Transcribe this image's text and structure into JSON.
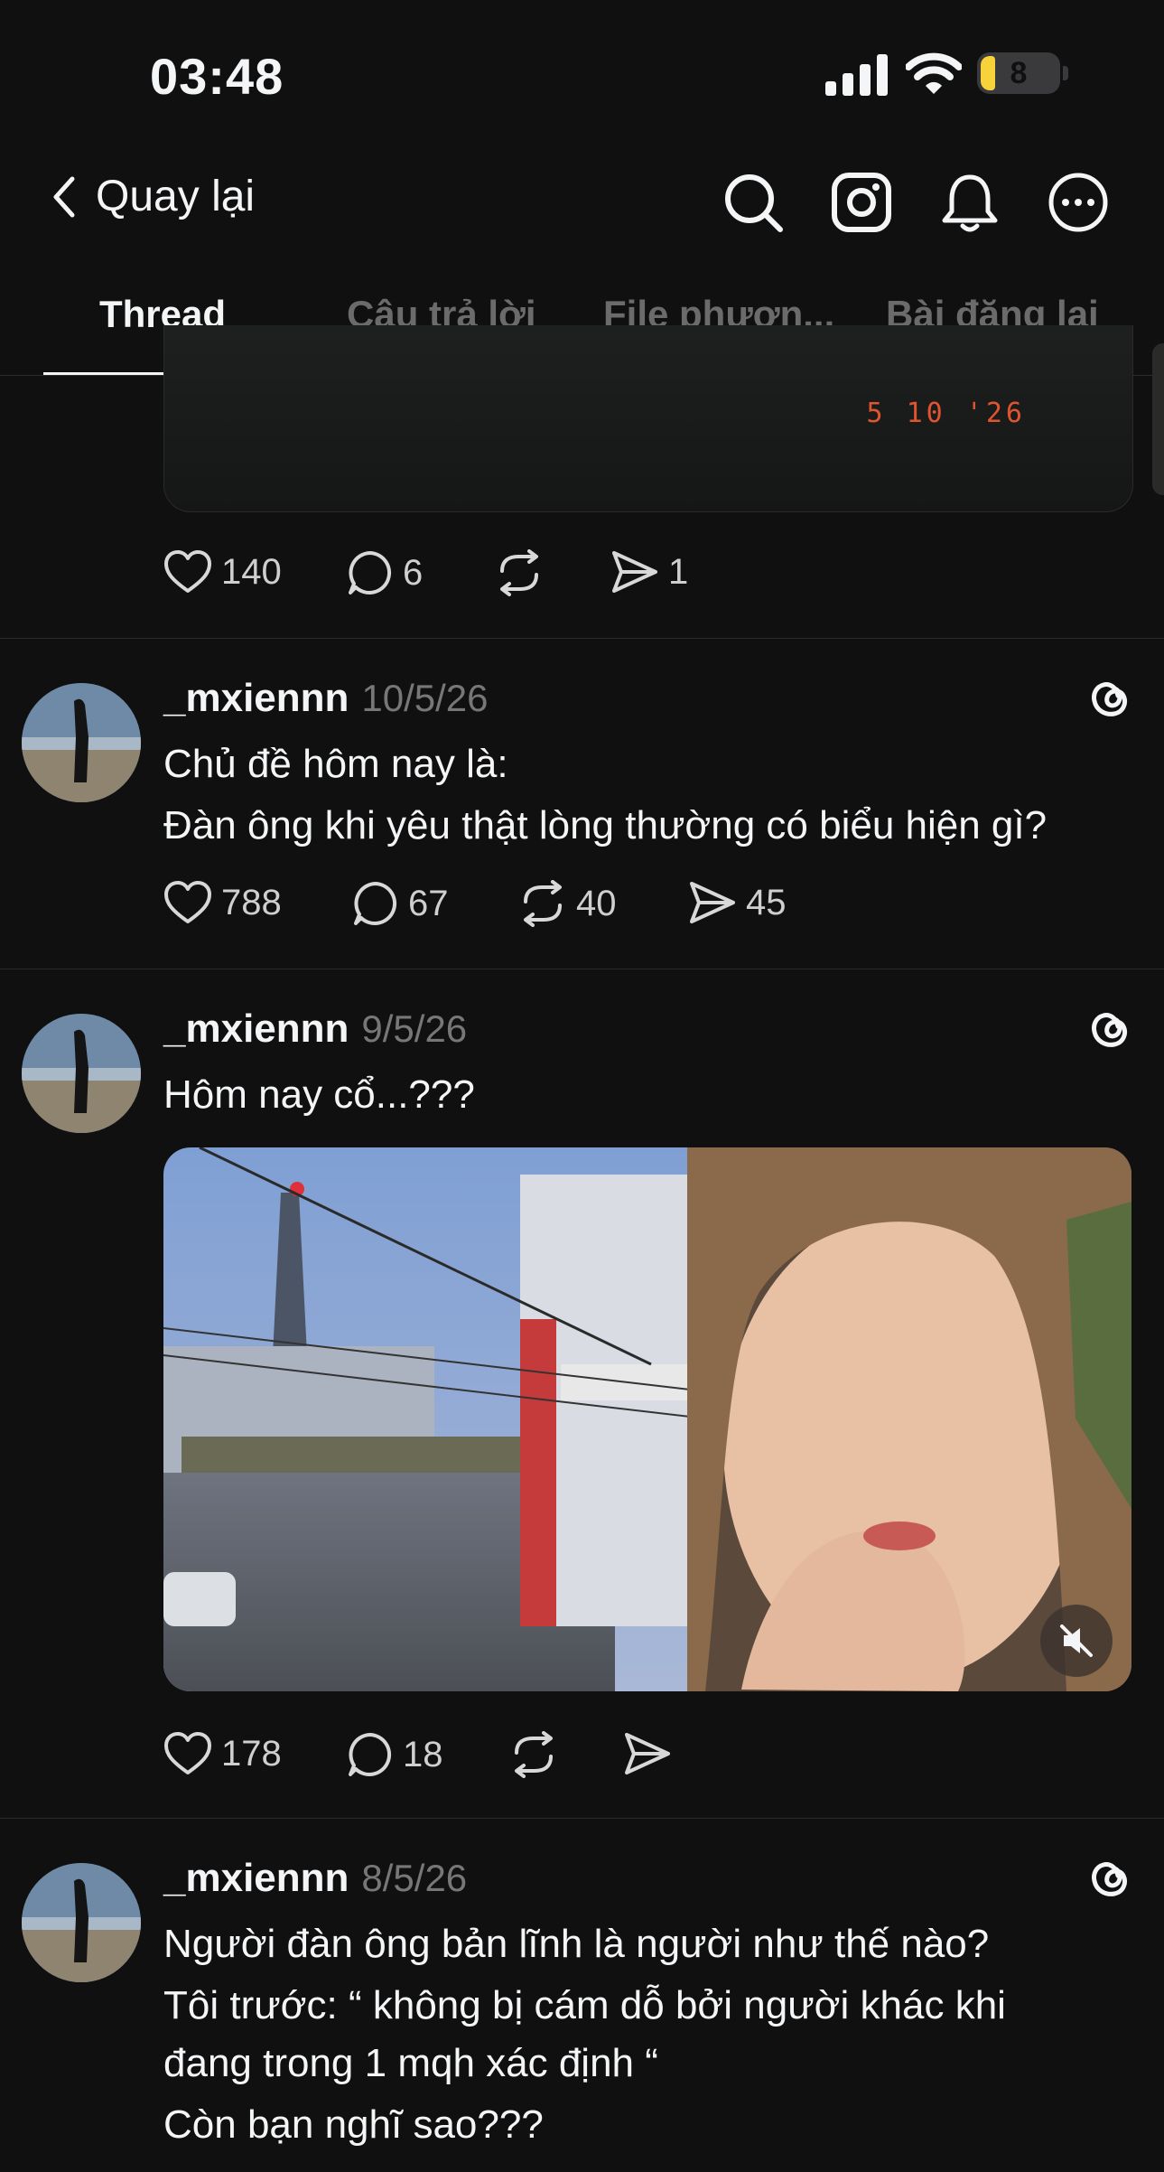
{
  "status_bar": {
    "time": "03:48",
    "battery": "8"
  },
  "nav": {
    "back_label": "Quay lại",
    "icons": [
      "search-icon",
      "instagram-icon",
      "bell-icon",
      "more-icon"
    ]
  },
  "tabs": [
    {
      "label": "Thread",
      "active": true
    },
    {
      "label": "Câu trả lời",
      "active": false
    },
    {
      "label": "File phươn...",
      "active": false
    },
    {
      "label": "Bài đăng lại",
      "active": false
    }
  ],
  "posts": [
    {
      "media_stamp": "5  10  '26",
      "likes": "140",
      "replies": "6",
      "reposts": "",
      "shares": "1"
    },
    {
      "username": "_mxiennn",
      "date": "10/5/26",
      "lines": [
        "Chủ đề hôm nay là:",
        "Đàn ông khi yêu thật lòng thường có biểu hiện gì?"
      ],
      "likes": "788",
      "replies": "67",
      "reposts": "40",
      "shares": "45"
    },
    {
      "username": "_mxiennn",
      "date": "9/5/26",
      "lines": [
        "Hôm nay cổ...???"
      ],
      "likes": "178",
      "replies": "18",
      "reposts": "",
      "shares": ""
    },
    {
      "username": "_mxiennn",
      "date": "8/5/26",
      "lines": [
        "Người đàn ông bản lĩnh là người như thế nào?",
        "Tôi trước: “ không bị cám dỗ bởi người khác khi",
        "đang trong 1 mqh xác định “",
        "Còn bạn nghĩ sao???"
      ]
    }
  ],
  "colors": {
    "background": "#101010",
    "text": "#f3f5f7",
    "muted": "#777777",
    "stamp": "#e0542f"
  }
}
